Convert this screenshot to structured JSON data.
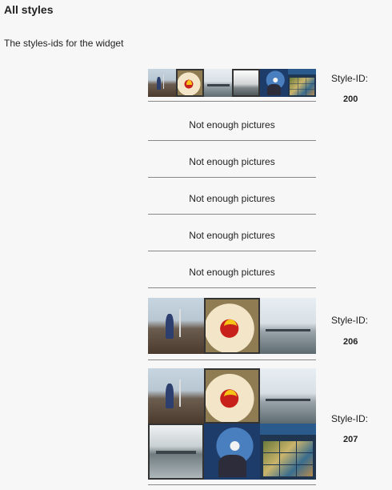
{
  "heading": {
    "title": "All styles",
    "subtitle": "The styles-ids for the widget"
  },
  "labels": {
    "style_id": "Style-ID:",
    "not_enough": "Not enough pictures"
  },
  "styles": [
    {
      "id": "200",
      "thumbnails": [
        "kid-on-pier-photo",
        "mcdonalds-fries-photo",
        "pier-photo",
        "bw-landscape-photo",
        "blue-party-photo",
        "app-screenshot-photo"
      ]
    },
    {
      "id": null,
      "message": "Not enough pictures"
    },
    {
      "id": null,
      "message": "Not enough pictures"
    },
    {
      "id": null,
      "message": "Not enough pictures"
    },
    {
      "id": null,
      "message": "Not enough pictures"
    },
    {
      "id": null,
      "message": "Not enough pictures"
    },
    {
      "id": "206",
      "thumbnails": [
        "kid-on-pier-photo",
        "mcdonalds-fries-photo",
        "pier-photo"
      ]
    },
    {
      "id": "207",
      "thumbnails": [
        "kid-on-pier-photo",
        "mcdonalds-fries-photo",
        "pier-photo",
        "dock-photo",
        "blue-party-photo",
        "app-screenshot-photo"
      ]
    }
  ]
}
